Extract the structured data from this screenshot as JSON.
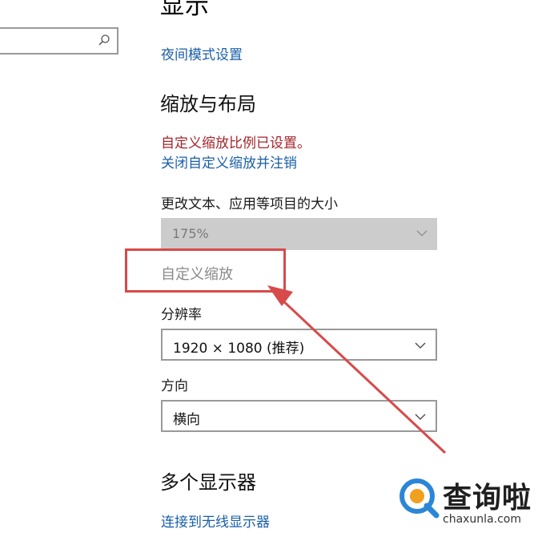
{
  "header": {
    "title_partial": "显示"
  },
  "search": {
    "placeholder": ""
  },
  "night_light": {
    "link": "夜间模式设置"
  },
  "scale_layout": {
    "heading": "缩放与布局",
    "warning": "自定义缩放比例已设置。",
    "close_link": "关闭自定义缩放并注销",
    "text_size_label": "更改文本、应用等项目的大小",
    "scale_value": "175%",
    "custom_scaling_link": "自定义缩放"
  },
  "resolution": {
    "label": "分辨率",
    "value": "1920 × 1080 (推荐)"
  },
  "orientation": {
    "label": "方向",
    "value": "横向"
  },
  "multi_display": {
    "heading": "多个显示器",
    "wireless_link": "连接到无线显示器"
  },
  "watermark": {
    "brand": "查询啦",
    "url": "chaxunla.com"
  },
  "colors": {
    "link": "#1a5fa8",
    "warning": "#a4262c",
    "annotation": "#d84a4a"
  }
}
